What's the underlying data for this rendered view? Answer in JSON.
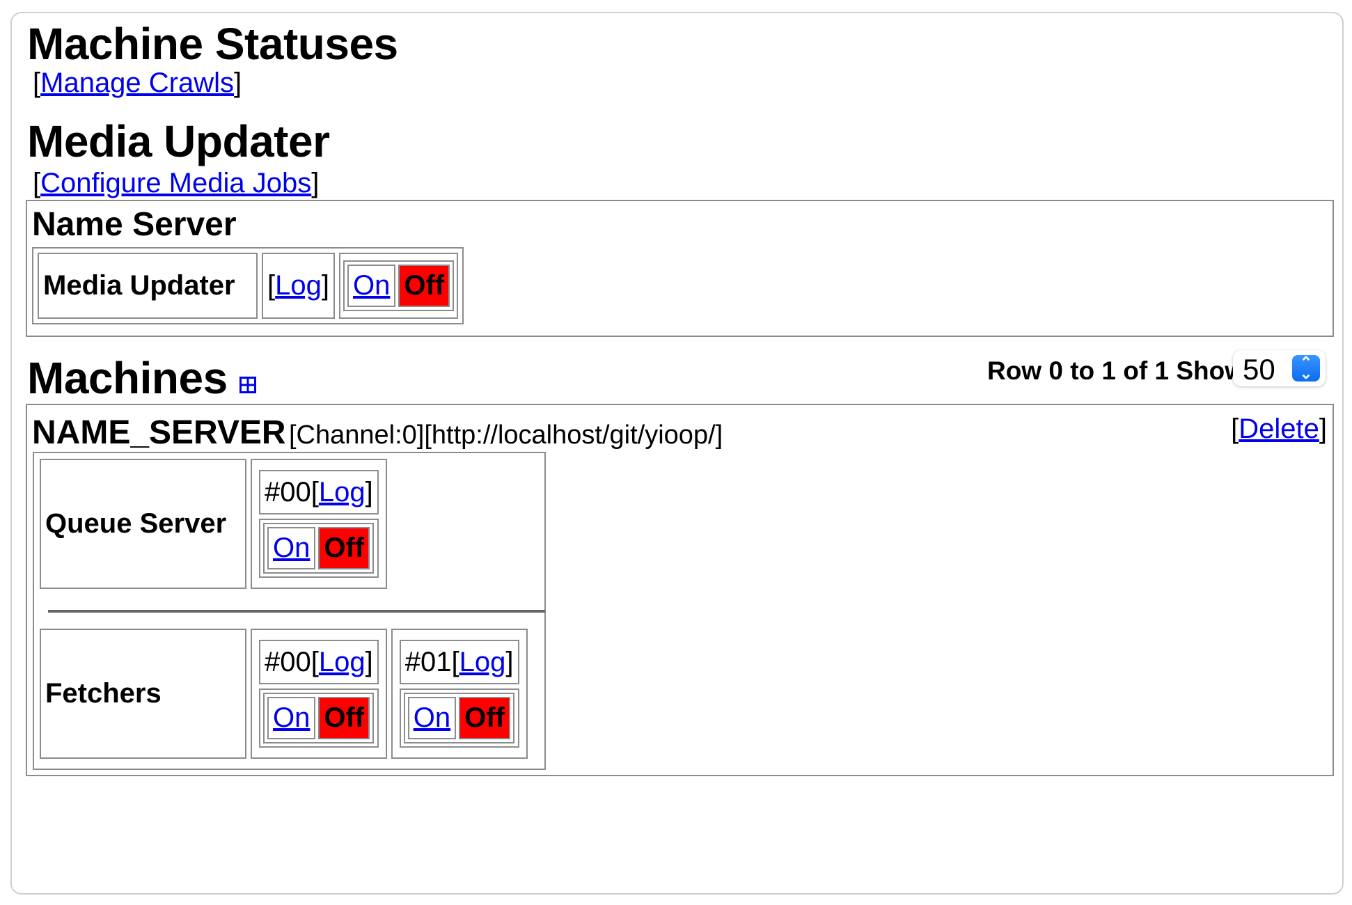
{
  "page": {
    "title": "Machine Statuses",
    "manage_crawls": {
      "open": "[",
      "label": "Manage Crawls",
      "close": "]"
    }
  },
  "media_updater": {
    "title": "Media Updater",
    "configure": {
      "open": "[",
      "label": "Configure Media Jobs",
      "close": "]"
    },
    "name_server": {
      "heading": "Name Server",
      "row": {
        "label": "Media Updater",
        "log_open": "[",
        "log_label": "Log",
        "log_close": "]",
        "on_label": "On",
        "off_label": "Off",
        "status": "off"
      }
    }
  },
  "machines": {
    "title": "Machines",
    "add_icon": "grid-plus-icon",
    "pager_text": "Row 0 to 1 of 1 Show",
    "show_select": {
      "value": "50"
    },
    "list": [
      {
        "name": "NAME_SERVER",
        "info": "[Channel:0][http://localhost/git/yioop/]",
        "delete": {
          "open": "[",
          "label": "Delete",
          "close": "]"
        },
        "queue_server": {
          "label": "Queue Server",
          "processes": [
            {
              "id": "#00",
              "log_open": "[",
              "log_label": "Log",
              "log_close": "]",
              "on_label": "On",
              "off_label": "Off",
              "status": "off"
            }
          ]
        },
        "fetchers": {
          "label": "Fetchers",
          "processes": [
            {
              "id": "#00",
              "log_open": "[",
              "log_label": "Log",
              "log_close": "]",
              "on_label": "On",
              "off_label": "Off",
              "status": "off"
            },
            {
              "id": "#01",
              "log_open": "[",
              "log_label": "Log",
              "log_close": "]",
              "on_label": "On",
              "off_label": "Off",
              "status": "off"
            }
          ]
        }
      }
    ]
  },
  "colors": {
    "link": "#0000ee",
    "off_active": "#ff0000",
    "border": "#8c8c8c"
  }
}
